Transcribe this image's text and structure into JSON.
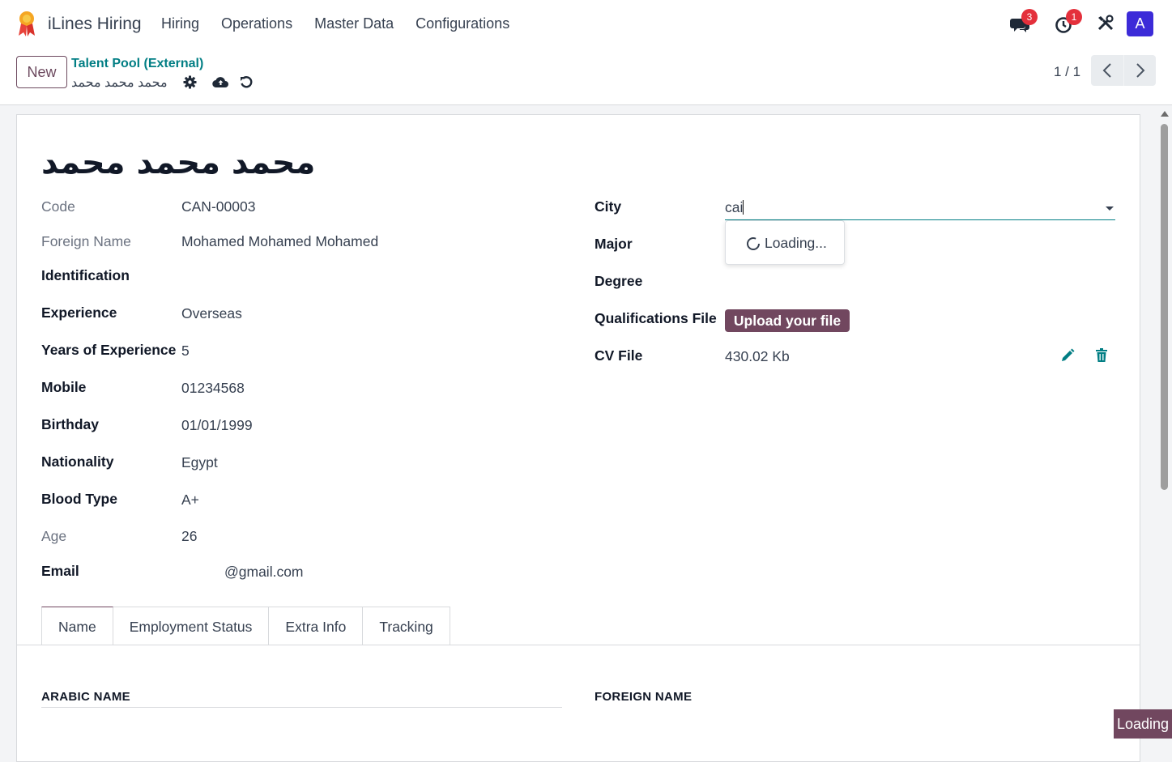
{
  "app": {
    "name": "iLines Hiring"
  },
  "menu": [
    "Hiring",
    "Operations",
    "Master Data",
    "Configurations"
  ],
  "topbar": {
    "messages_count": "3",
    "activities_count": "1",
    "avatar_letter": "A",
    "icons": [
      "chat-icon",
      "clock-icon",
      "tools-icon"
    ]
  },
  "control": {
    "new_label": "New",
    "breadcrumb": "Talent Pool (External)",
    "record_name": "محمد محمد محمد",
    "pager": "1 / 1"
  },
  "form": {
    "title": "محمد محمد محمد",
    "left": [
      {
        "label": "Code",
        "value": "CAN-00003",
        "style": "muted"
      },
      {
        "label": "Foreign Name",
        "value": "Mohamed Mohamed Mohamed",
        "style": "muted"
      },
      {
        "label": "Identification",
        "value": "",
        "style": "bold"
      },
      {
        "label": "Experience",
        "value": "Overseas",
        "style": "bold"
      },
      {
        "label": "Years of Experience",
        "value": "5",
        "style": "bold"
      },
      {
        "label": "Mobile",
        "value": "01234568",
        "style": "bold"
      },
      {
        "label": "Birthday",
        "value": "01/01/1999",
        "style": "bold"
      },
      {
        "label": "Nationality",
        "value": "Egypt",
        "style": "bold"
      },
      {
        "label": "Blood Type",
        "value": "A+",
        "style": "bold"
      },
      {
        "label": "Age",
        "value": "26",
        "style": "muted"
      },
      {
        "label": "Email",
        "value": "@gmail.com",
        "style": "bold"
      }
    ],
    "right": {
      "city_label": "City",
      "city_value": "cai",
      "major_label": "Major",
      "degree_label": "Degree",
      "qualifications_label": "Qualifications File",
      "upload_label": "Upload your file",
      "cv_label": "CV File",
      "cv_value": "430.02 Kb"
    },
    "dropdown": {
      "loading_text": "Loading..."
    }
  },
  "tabs": [
    "Name",
    "Employment Status",
    "Extra Info",
    "Tracking"
  ],
  "sections": {
    "arabic_name": "ARABIC NAME",
    "foreign_name": "FOREIGN NAME"
  },
  "status": {
    "loading_badge": "Loading"
  },
  "colors": {
    "brand": "#71475f",
    "accent": "#017e84",
    "badge": "#e4303c",
    "avatar": "#3c2bd8"
  }
}
